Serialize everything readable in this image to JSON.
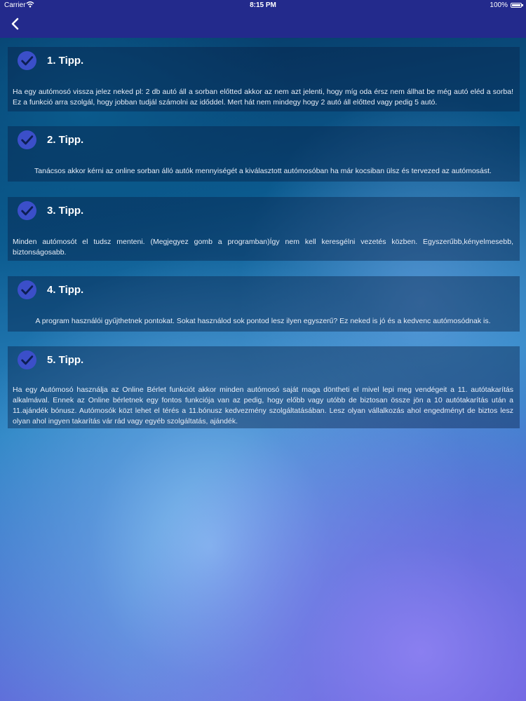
{
  "status_bar": {
    "carrier": "Carrier",
    "time": "8:15 PM",
    "battery": "100%"
  },
  "nav": {
    "back_icon": "chevron-left-icon"
  },
  "colors": {
    "nav_bar": "#232a8c",
    "check_icon": "#3b4fc9"
  },
  "tips": [
    {
      "title": "1. Tipp.",
      "text": "Ha egy  autómosó vissza jelez neked pl: 2 db autó áll a sorban előtted akkor az nem azt  jelenti, hogy míg oda érsz nem állhat be még autó eléd a sorba! Ez a funkció  arra szolgál, hogy jobban tudjál számolni az időddel. Mert hát nem mindegy hogy  2 autó áll előtted vagy pedig 5 autó."
    },
    {
      "title": "2. Tipp.",
      "text": "Tanácsos  akkor kérni az online sorban álló autók mennyiségét a kiválasztott autómosóban  ha már kocsiban ülsz és tervezed az autómosást."
    },
    {
      "title": "3. Tipp.",
      "text": "Minden  autómosót  el  tudsz  menteni.  (Megjegyez  gomb  a  programban)Így  nem  kell   keresgélni  vezetés  közben.  Egyszerűbb,kényelmesebb, biztonságosabb."
    },
    {
      "title": "4. Tipp.",
      "text": "A program  használói gyűjthetnek pontokat. Sokat használod sok pontod lesz ilyen egyszerű? Ez neked is jó és a kedvenc autómosódnak is."
    },
    {
      "title": "5. Tipp.",
      "text": "Ha egy  Autómosó használja az Online Bérlet funkciót akkor minden autómosó saját maga  döntheti el mivel lepi meg vendégeit a 11.  autótakarítás alkalmával. Ennek az  Online bérletnek egy fontos funkciója van az pedig, hogy előbb vagy utóbb de  biztosan össze jön a 10 autótakarítás után a 11.ajándék bónusz. Autómosók  közt lehet el térés a 11.bónusz kedvezmény szolgáltatásában. Lesz olyan vállalkozás ahol engedményt de biztos lesz olyan ahol ingyen  takarítás vár rád vagy egyéb szolgáltatás, ajándék."
    }
  ]
}
